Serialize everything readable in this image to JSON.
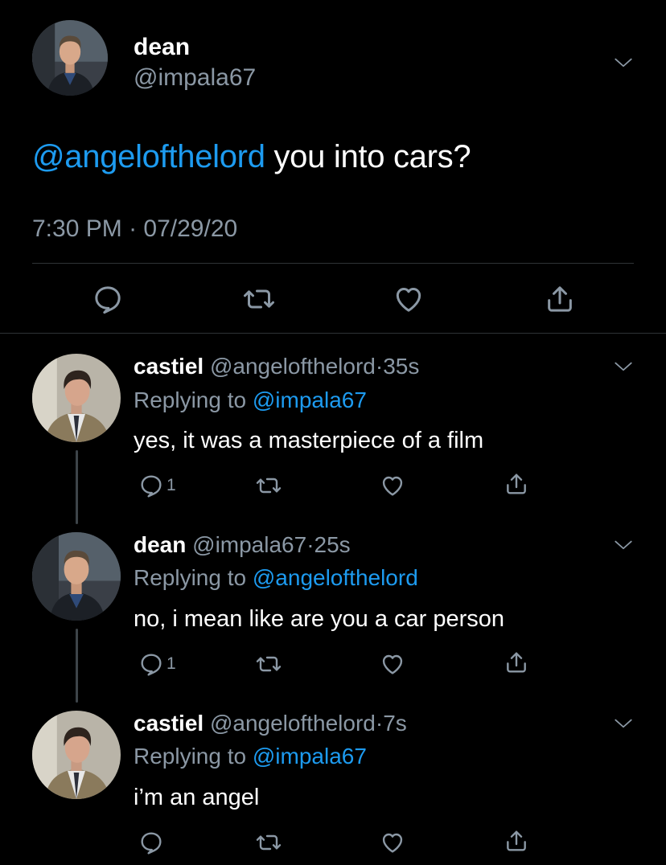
{
  "main_tweet": {
    "display_name": "dean",
    "handle": "@impala67",
    "mention": "@angelofthelord",
    "text": " you into cars?",
    "time": "7:30 PM",
    "dot": "·",
    "date": "07/29/20"
  },
  "replies": [
    {
      "display_name": "castiel",
      "handle": "@angelofthelord",
      "dot": "·",
      "age": "35s",
      "replying_prefix": "Replying to ",
      "replying_to": "@impala67",
      "text": "yes, it was a masterpiece of a film",
      "reply_count": "1"
    },
    {
      "display_name": "dean",
      "handle": "@impala67",
      "dot": "·",
      "age": "25s",
      "replying_prefix": "Replying to ",
      "replying_to": "@angelofthelord",
      "text": "no, i mean like are you a car person",
      "reply_count": "1"
    },
    {
      "display_name": "castiel",
      "handle": "@angelofthelord",
      "dot": "·",
      "age": "7s",
      "replying_prefix": "Replying to ",
      "replying_to": "@impala67",
      "text": "i’m an angel",
      "reply_count": ""
    }
  ],
  "colors": {
    "background": "#000000",
    "link": "#1d9bf0",
    "muted": "#8b98a5",
    "divider": "#2f3336"
  },
  "icons": [
    "reply-icon",
    "retweet-icon",
    "like-icon",
    "share-icon",
    "chevron-down-icon"
  ]
}
